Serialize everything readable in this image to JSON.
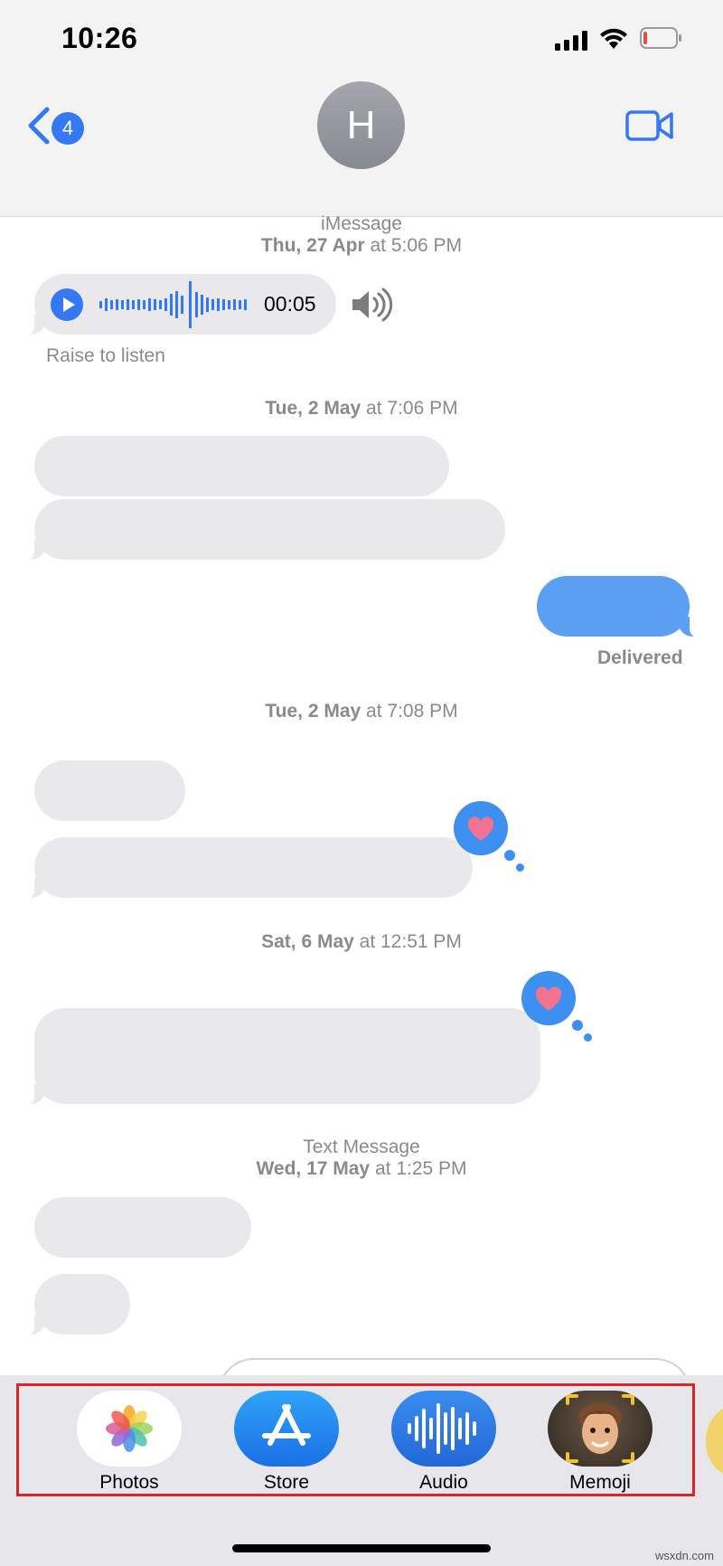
{
  "status": {
    "time": "10:26"
  },
  "nav": {
    "back_count": "4",
    "avatar_initial": "H"
  },
  "thread": {
    "stamp1": {
      "service": "iMessage",
      "day": "Thu, 27 Apr",
      "time": "at 5:06 PM"
    },
    "audio": {
      "duration": "00:05",
      "hint": "Raise to listen"
    },
    "stamp2": {
      "day": "Tue, 2 May",
      "time": "at 7:06 PM"
    },
    "delivered": "Delivered",
    "stamp3": {
      "day": "Tue, 2 May",
      "time": "at 7:08 PM"
    },
    "stamp4": {
      "day": "Sat, 6 May",
      "time": "at 12:51 PM"
    },
    "stamp5": {
      "service": "Text Message",
      "day": "Wed, 17 May",
      "time": "at 1:25 PM"
    }
  },
  "apps": [
    {
      "label": "Photos",
      "icon": "photos-icon"
    },
    {
      "label": "Store",
      "icon": "app-store-icon"
    },
    {
      "label": "Audio",
      "icon": "audio-waveform-icon"
    },
    {
      "label": "Memoji",
      "icon": "memoji-icon"
    }
  ],
  "colors": {
    "accent": "#3478f6",
    "sent_bubble": "#5a9ff2",
    "received_bubble": "#e9e9eb",
    "highlight": "#d9262c",
    "tapback_heart": "#f2738f"
  },
  "watermark": "wsxdn.com"
}
